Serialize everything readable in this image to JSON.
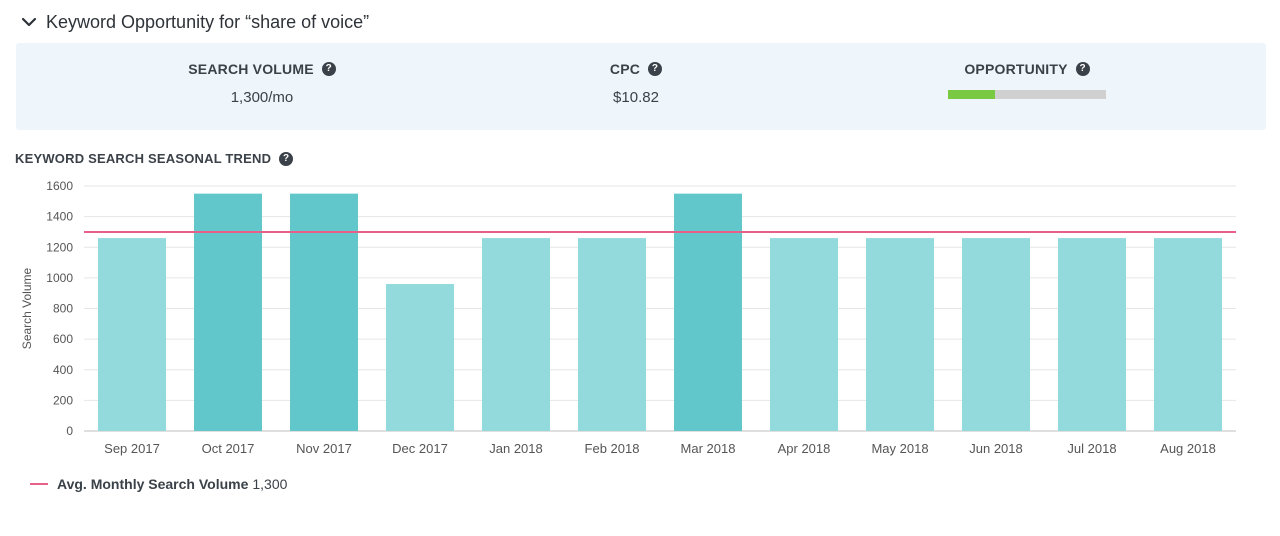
{
  "header": {
    "title": "Keyword Opportunity for “share of voice”",
    "toggle_icon": "chevron-down-icon"
  },
  "stats": {
    "search_volume": {
      "label": "SEARCH VOLUME",
      "value": "1,300/mo",
      "help_icon": "question-circle-icon"
    },
    "cpc": {
      "label": "CPC",
      "value": "$10.82",
      "help_icon": "question-circle-icon"
    },
    "opportunity": {
      "label": "OPPORTUNITY",
      "value_fraction": 0.3,
      "help_icon": "question-circle-icon"
    }
  },
  "trend": {
    "title": "KEYWORD SEARCH SEASONAL TREND",
    "help_icon": "question-circle-icon"
  },
  "chart_data": {
    "type": "bar",
    "title": "KEYWORD SEARCH SEASONAL TREND",
    "ylabel": "Search Volume",
    "xlabel": "",
    "ylim": [
      0,
      1600
    ],
    "yticks": [
      0,
      200,
      400,
      600,
      800,
      1000,
      1200,
      1400,
      1600
    ],
    "grid": true,
    "categories": [
      "Sep 2017",
      "Oct 2017",
      "Nov 2017",
      "Dec 2017",
      "Jan 2018",
      "Feb 2018",
      "Mar 2018",
      "Apr 2018",
      "May 2018",
      "Jun 2018",
      "Jul 2018",
      "Aug 2018"
    ],
    "values": [
      1260,
      1550,
      1550,
      960,
      1260,
      1260,
      1550,
      1260,
      1260,
      1260,
      1260,
      1260
    ],
    "highlighted": [
      false,
      true,
      true,
      false,
      false,
      false,
      true,
      false,
      false,
      false,
      false,
      false
    ],
    "average_line": {
      "label": "Avg. Monthly Search Volume",
      "value": 1300,
      "value_text": "1,300"
    },
    "colors": {
      "bar": "#93dadd",
      "bar_highlight": "#62c7cb",
      "average_line": "#e8608a",
      "grid": "#e6e6e6"
    },
    "legend_position": "bottom-left"
  }
}
